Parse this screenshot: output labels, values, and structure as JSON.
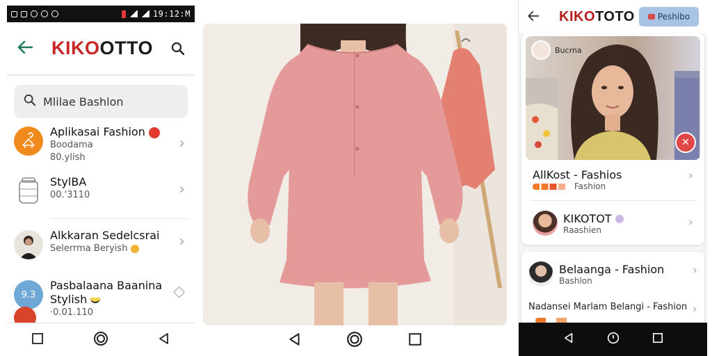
{
  "left_phone": {
    "status_time": "19:12:M",
    "brand": {
      "part1": "KIKO",
      "part2": "OTTO"
    },
    "search": {
      "placeholder": "Mlilae Bashlon"
    },
    "items": [
      {
        "title": "Aplikasai Fashion",
        "line2": "Boodama",
        "line3": "80.ylish",
        "avatar_color": "#f08a1c",
        "icon": "hanger-icon"
      },
      {
        "title": "StylBA",
        "line2": "00.'3110",
        "icon": "jar-icon"
      },
      {
        "title": "Alkkaran Sedelcsrai",
        "line2": "Selerrma Beryish",
        "icon": "person-avatar"
      },
      {
        "title": "Pasbalaana Baanina",
        "line2": "Stylish",
        "line3": "·0.01.110",
        "avatar_label": "9.3",
        "avatar_color": "#6fa8d6"
      }
    ]
  },
  "right_phone": {
    "brand": {
      "part1": "KIKO",
      "part2": "TOTO"
    },
    "pill_label": "Peshibo",
    "hero_chip": "Bucrna",
    "rows": [
      {
        "title": "AllKost - Fashios",
        "subtitle": "Fashion"
      },
      {
        "title": "KIKOTOT",
        "subtitle": "Raashien"
      },
      {
        "title": "Belaanga - Fashion",
        "subtitle": "Bashlon"
      },
      {
        "title": "Nadansei Marlam Belangi - Fashion"
      }
    ]
  },
  "colors": {
    "brand_red": "#c62828",
    "accent_green": "#1a7a55",
    "pill_blue": "#a9c3e6"
  }
}
